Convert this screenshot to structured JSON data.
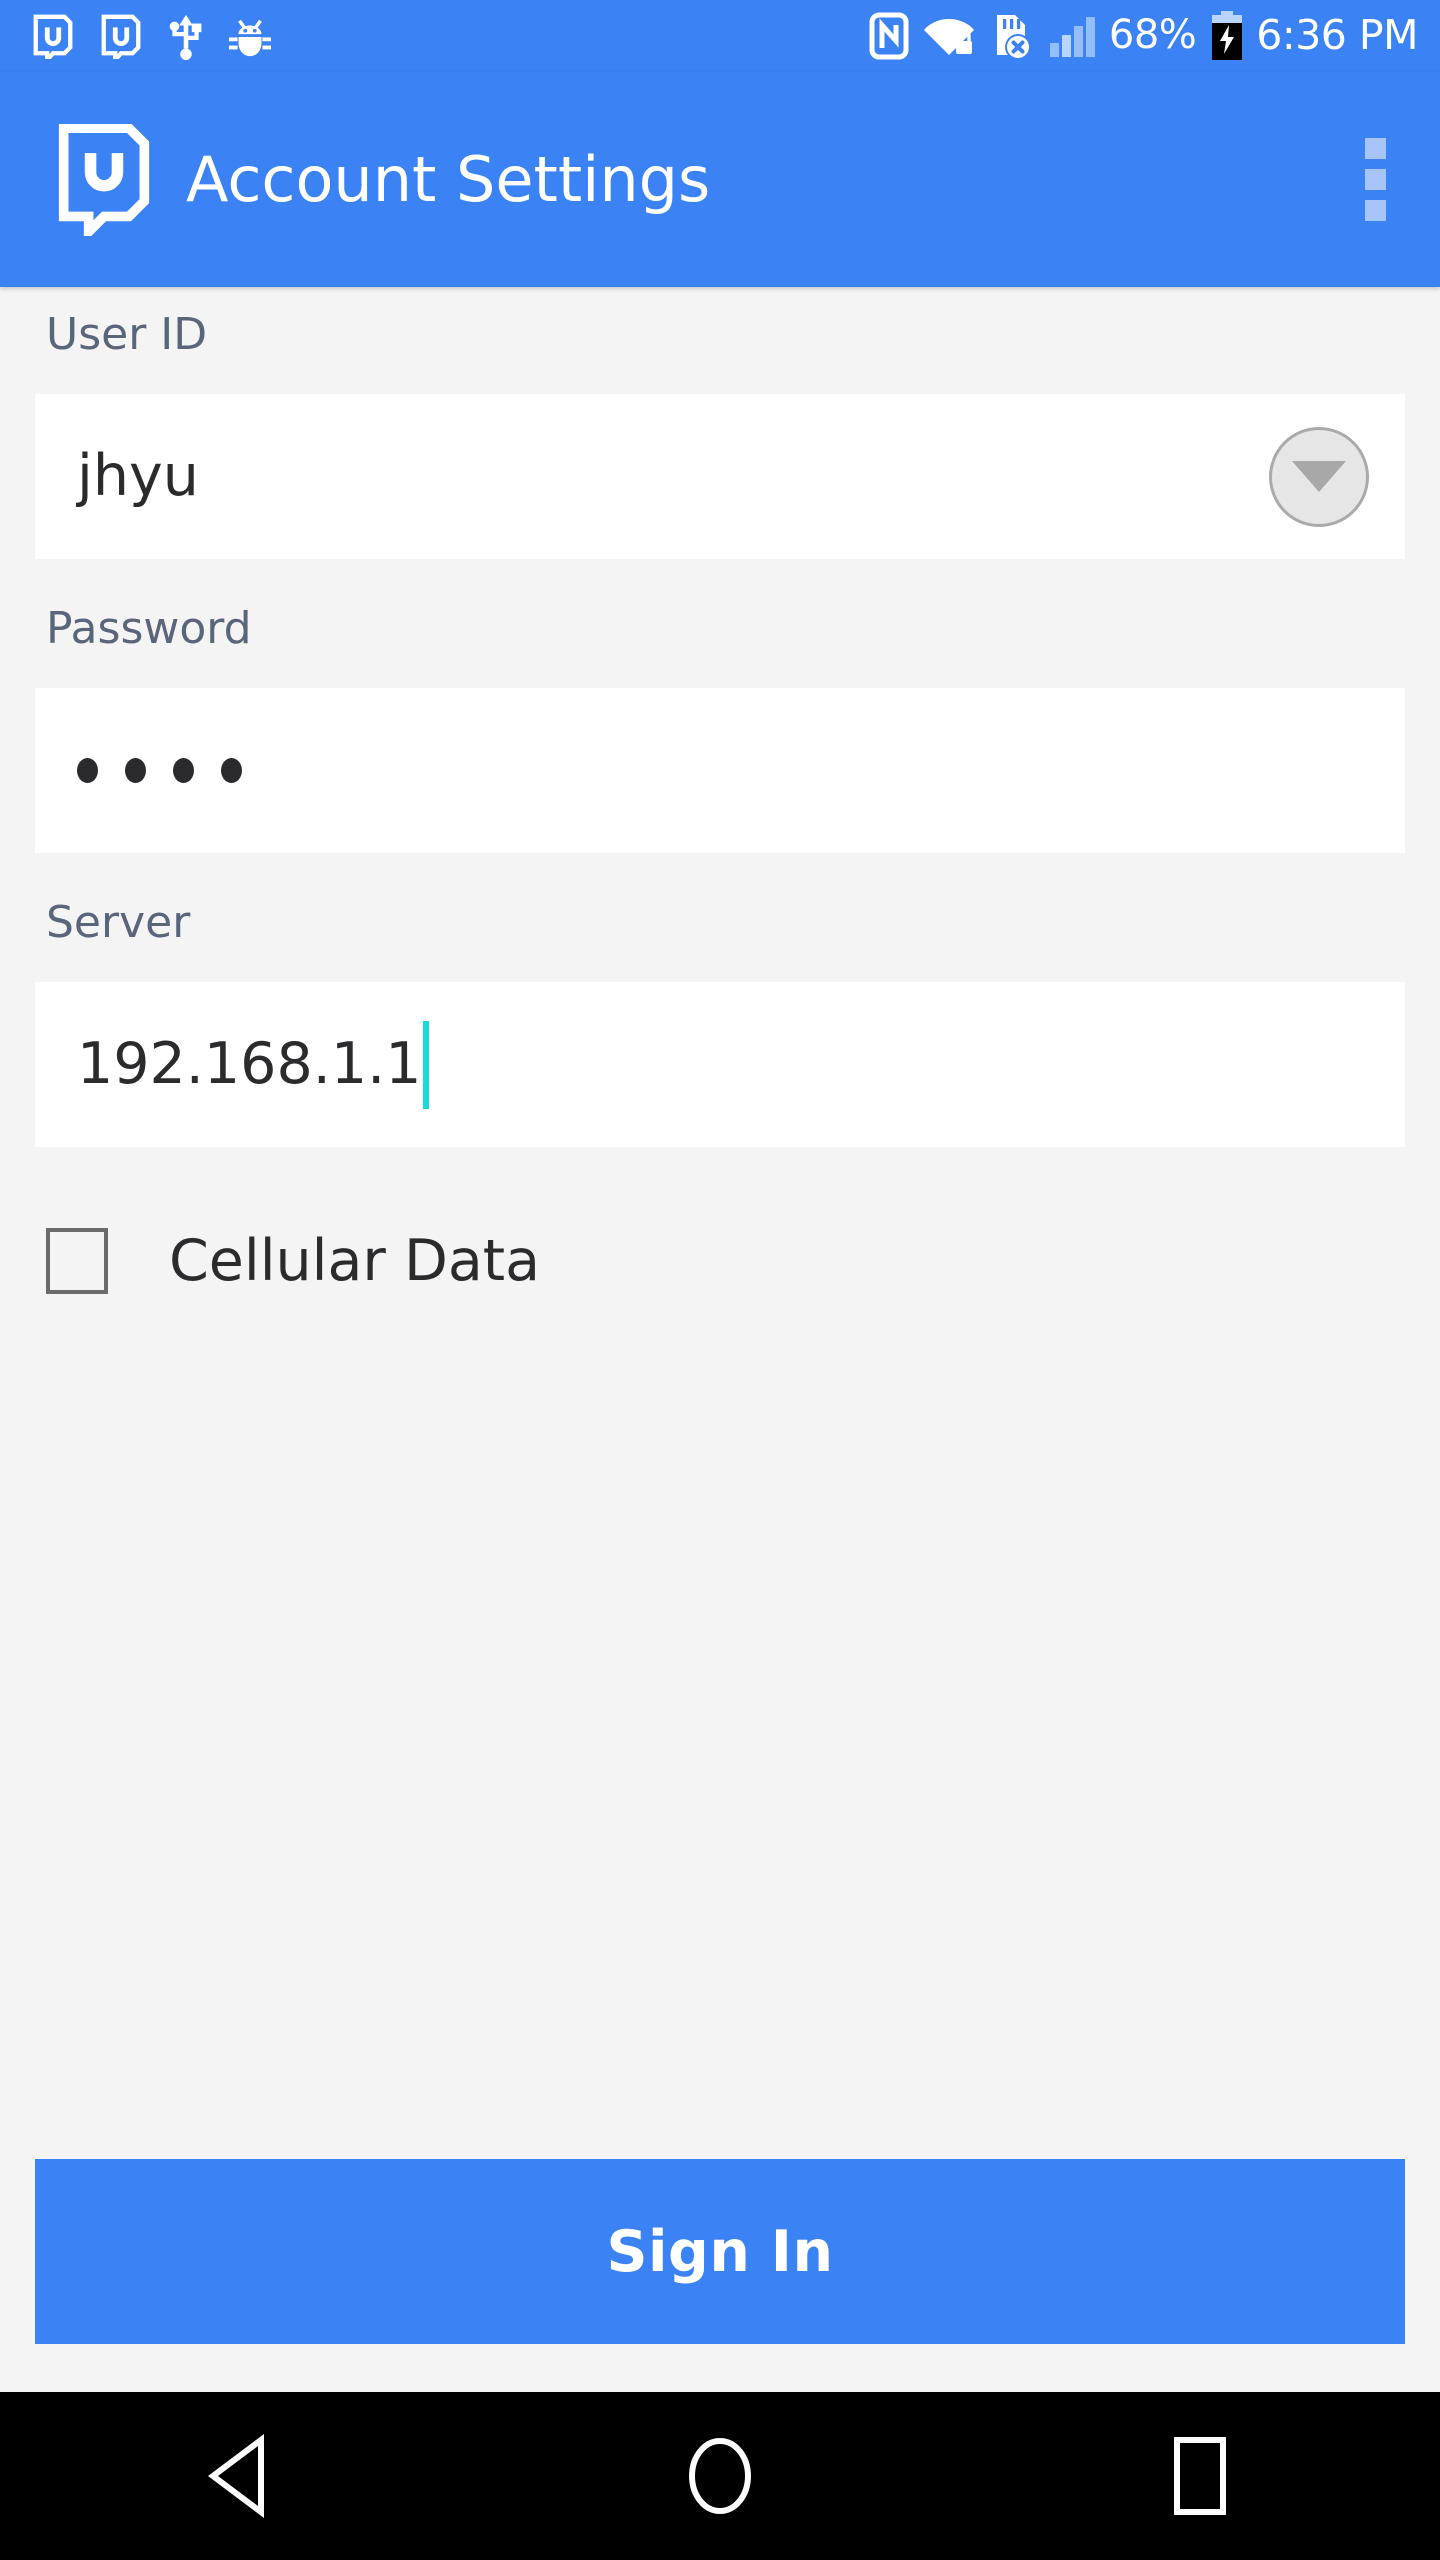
{
  "status_bar": {
    "left_icons": [
      {
        "name": "app-notification-icon-1",
        "glyph": "app-bubble"
      },
      {
        "name": "app-notification-icon-2",
        "glyph": "app-bubble"
      },
      {
        "name": "usb-icon",
        "glyph": "usb"
      },
      {
        "name": "debug-bug-icon",
        "glyph": "bug"
      }
    ],
    "right_icons": [
      {
        "name": "nfc-icon",
        "glyph": "nfc"
      },
      {
        "name": "wifi-locked-icon",
        "glyph": "wifi-lock"
      },
      {
        "name": "sd-card-error-icon",
        "glyph": "sd-x"
      },
      {
        "name": "cellular-signal-icon",
        "glyph": "signal-bars"
      }
    ],
    "battery_percent": "68%",
    "battery_state": "charging",
    "time": "6:36 PM"
  },
  "app_bar": {
    "logo_name": "unicon-app-logo",
    "title": "Account Settings",
    "overflow_label": "More options"
  },
  "form": {
    "user_id": {
      "label": "User ID",
      "value": "jhyu",
      "dropdown_name": "user-id-dropdown-button"
    },
    "password": {
      "label": "Password",
      "masked_value": "••••",
      "dot_count": 4
    },
    "server": {
      "label": "Server",
      "value": "192.168.1.1",
      "focused": true
    },
    "cellular_data": {
      "label": "Cellular Data",
      "checked": false
    }
  },
  "actions": {
    "sign_in_label": "Sign In"
  },
  "nav_bar": {
    "back_label": "Back",
    "home_label": "Home",
    "recents_label": "Recents"
  },
  "colors": {
    "primary_blue": "#3b82f5",
    "background": "#f4f4f5",
    "field_background": "#ffffff",
    "label_text": "#59657a",
    "value_text": "#2b2b2d",
    "caret": "#1ad9d6",
    "nav_background": "#000000"
  }
}
